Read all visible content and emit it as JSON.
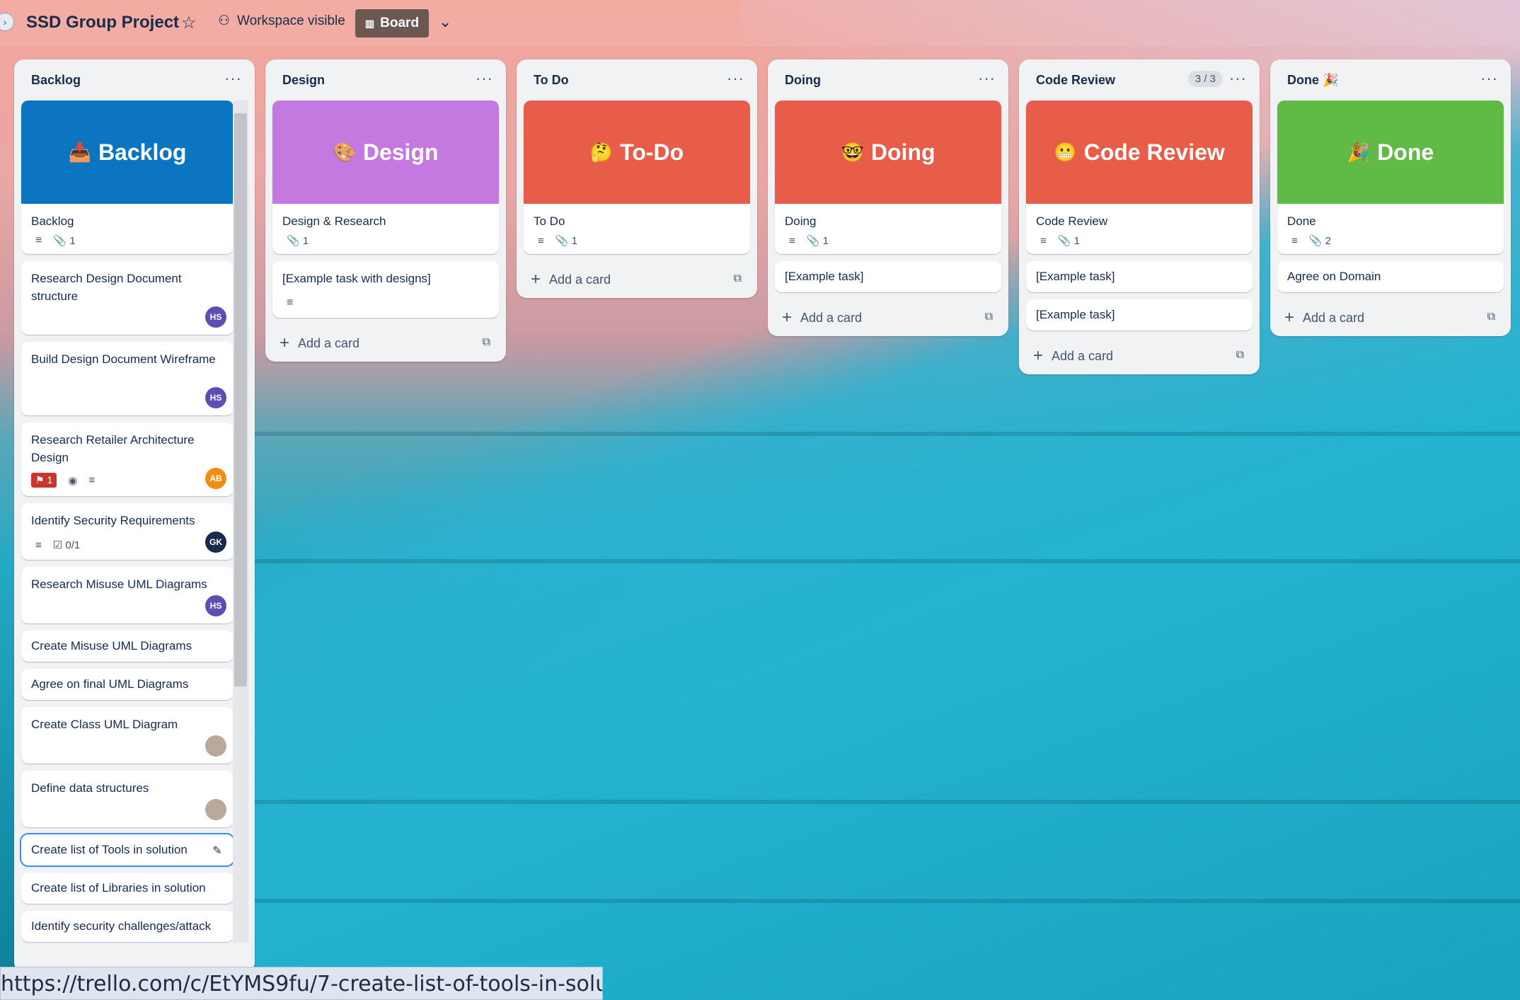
{
  "topbar": {
    "board_title": "SSD Group Project",
    "visibility": "Workspace visible",
    "view": "Board"
  },
  "lists": [
    {
      "title": "Backlog",
      "cover": {
        "text": "Backlog",
        "emoji": "📥",
        "color": "#0c75c2"
      },
      "cards": [
        {
          "title": "Backlog",
          "badges": [
            "description",
            "attachments 1"
          ]
        },
        {
          "title": "Research Design Document structure",
          "avatar": "HS"
        },
        {
          "title": "Build Design Document Wireframe",
          "avatar": "HS"
        },
        {
          "title": "Research Retailer Architecture Design",
          "label": "1",
          "avatar": "AB"
        },
        {
          "title": "Identify Security Requirements",
          "checklist": "0/1",
          "avatar": "GK"
        },
        {
          "title": "Research Misuse UML Diagrams",
          "avatar": "HS"
        },
        {
          "title": "Create Misuse UML Diagrams"
        },
        {
          "title": "Agree on final UML Diagrams"
        },
        {
          "title": "Create Class UML Diagram",
          "avatar": "photo"
        },
        {
          "title": "Define data structures",
          "avatar": "photo"
        },
        {
          "title": "Create list of Tools in solution",
          "focused": true
        },
        {
          "title": "Create list of Libraries in solution"
        },
        {
          "title": "Identify security challenges/attack"
        }
      ]
    },
    {
      "title": "Design",
      "cover": {
        "text": "Design",
        "emoji": "🎨",
        "color": "#c379e0"
      },
      "cards": [
        {
          "title": "Design & Research",
          "attachments": "1"
        },
        {
          "title": "[Example task with designs]"
        }
      ],
      "add_label": "Add a card"
    },
    {
      "title": "To Do",
      "cover": {
        "text": "To-Do",
        "emoji": "🤔",
        "color": "#e85c4a"
      },
      "cards": [
        {
          "title": "To Do",
          "attachments": "1"
        }
      ],
      "add_label": "Add a card"
    },
    {
      "title": "Doing",
      "cover": {
        "text": "Doing",
        "emoji": "🤓",
        "color": "#e85c4a"
      },
      "cards": [
        {
          "title": "Doing",
          "attachments": "1"
        },
        {
          "title": "[Example task]"
        }
      ],
      "add_label": "Add a card"
    },
    {
      "title": "Code Review",
      "count": "3 / 3",
      "cover": {
        "text": "Code Review",
        "emoji": "😬",
        "color": "#e85c4a"
      },
      "cards": [
        {
          "title": "Code Review",
          "attachments": "1"
        },
        {
          "title": "[Example task]"
        },
        {
          "title": "[Example task]"
        }
      ],
      "add_label": "Add a card"
    },
    {
      "title": "Done 🎉",
      "cover": {
        "text": "Done",
        "emoji": "🎉",
        "color": "#5fba46"
      },
      "cards": [
        {
          "title": "Done",
          "attachments": "2"
        },
        {
          "title": "Agree on Domain"
        }
      ],
      "add_label": "Add a card"
    }
  ],
  "status_url": "https://trello.com/c/EtYMS9fu/7-create-list-of-tools-in-solution",
  "colors": {
    "accent_blue": "#388bff",
    "text": "#172b4d"
  }
}
